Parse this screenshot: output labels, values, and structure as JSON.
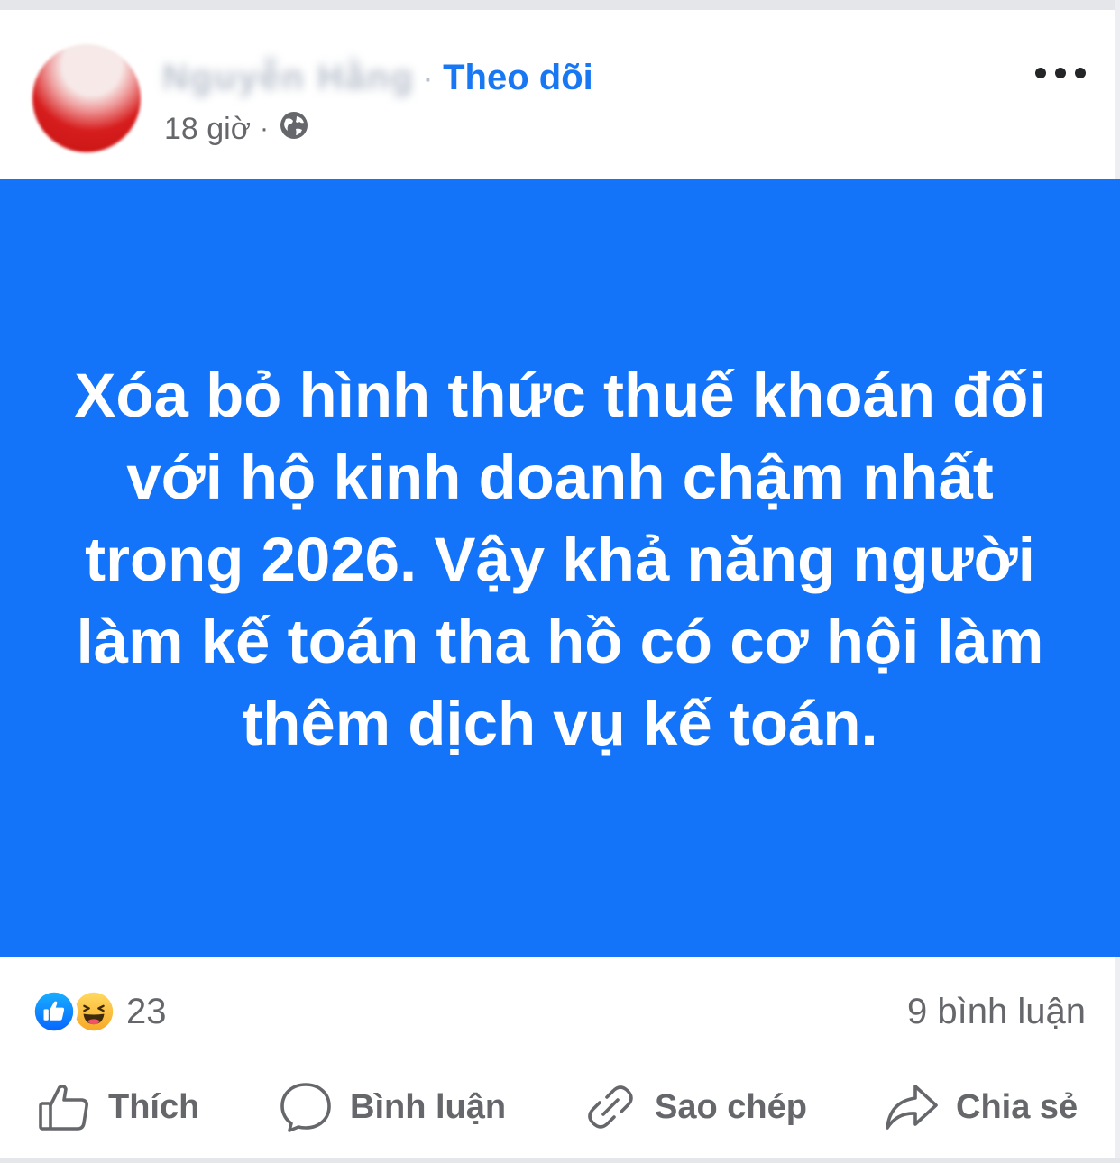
{
  "post": {
    "author": {
      "name": "Nguyễn Hằng",
      "follow_separator": "·",
      "follow_label": "Theo dõi"
    },
    "time": "18 giờ",
    "meta_separator": "·",
    "audience_icon": "globe-icon",
    "menu_icon": "more-horizontal-icon",
    "card": {
      "background_color": "#1374fa",
      "text_color": "#ffffff",
      "text": "Xóa bỏ hình thức thuế khoán đối với hộ kinh doanh chậm nhất trong 2026. Vậy khả năng người làm kế toán tha hồ có cơ hội làm thêm dịch vụ kế toán."
    },
    "reactions": {
      "types": [
        "like-icon",
        "haha-icon"
      ],
      "count": "23"
    },
    "comments_label": "9 bình luận",
    "actions": [
      {
        "icon": "thumbs-up-icon",
        "label": "Thích"
      },
      {
        "icon": "comment-bubble-icon",
        "label": "Bình luận"
      },
      {
        "icon": "link-icon",
        "label": "Sao chép"
      },
      {
        "icon": "share-arrow-icon",
        "label": "Chia sẻ"
      }
    ]
  },
  "colors": {
    "accent": "#1877f2",
    "secondary_text": "#65676b"
  }
}
